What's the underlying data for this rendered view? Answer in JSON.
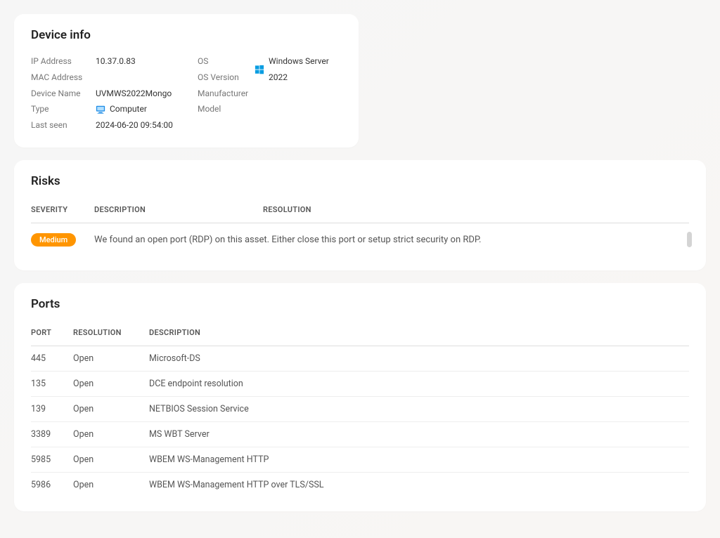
{
  "device_info": {
    "title": "Device info",
    "labels": {
      "ip": "IP Address",
      "mac": "MAC Address",
      "name": "Device Name",
      "type": "Type",
      "last_seen": "Last seen",
      "os": "OS",
      "os_version": "OS Version",
      "manufacturer": "Manufacturer",
      "model": "Model"
    },
    "values": {
      "ip": "10.37.0.83",
      "mac": "",
      "name": "UVMWS2022Mongo",
      "type": "Computer",
      "last_seen": "2024-06-20 09:54:00",
      "os": "Windows Server 2022",
      "os_version": "",
      "manufacturer": "",
      "model": ""
    }
  },
  "risks": {
    "title": "Risks",
    "headers": {
      "severity": "SEVERITY",
      "description": "DESCRIPTION",
      "resolution": "RESOLUTION"
    },
    "rows": [
      {
        "severity": "Medium",
        "text": "We found an open port (RDP) on this asset. Either close this port or setup strict security on RDP."
      }
    ]
  },
  "ports": {
    "title": "Ports",
    "headers": {
      "port": "PORT",
      "resolution": "RESOLUTION",
      "description": "DESCRIPTION"
    },
    "rows": [
      {
        "port": "445",
        "resolution": "Open",
        "description": "Microsoft-DS"
      },
      {
        "port": "135",
        "resolution": "Open",
        "description": "DCE endpoint resolution"
      },
      {
        "port": "139",
        "resolution": "Open",
        "description": "NETBIOS Session Service"
      },
      {
        "port": "3389",
        "resolution": "Open",
        "description": "MS WBT Server"
      },
      {
        "port": "5985",
        "resolution": "Open",
        "description": "WBEM WS-Management HTTP"
      },
      {
        "port": "5986",
        "resolution": "Open",
        "description": "WBEM WS-Management HTTP over TLS/SSL"
      }
    ]
  },
  "colors": {
    "badge_medium": "#ff9500",
    "windows_blue": "#0a9de1",
    "computer_blue": "#1f8de6"
  }
}
